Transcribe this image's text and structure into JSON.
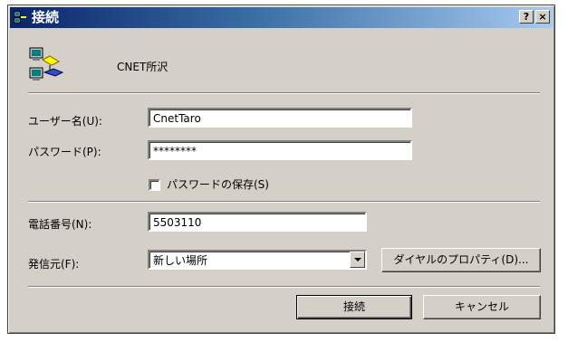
{
  "window": {
    "title": "接続",
    "help_button": "?",
    "close_button": "×"
  },
  "connection": {
    "name": "CNET所沢"
  },
  "username": {
    "label": "ユーザー名(U):",
    "value": "CnetTaro"
  },
  "password": {
    "label": "パスワード(P):",
    "value": "********"
  },
  "save_password": {
    "label": "パスワードの保存(S)",
    "checked": false
  },
  "phone": {
    "label": "電話番号(N):",
    "value": "5503110"
  },
  "dial_from": {
    "label": "発信元(F):",
    "selected": "新しい場所"
  },
  "dial_properties_button": "ダイヤルのプロパティ(D)...",
  "connect_button": "接続",
  "cancel_button": "キャンセル"
}
